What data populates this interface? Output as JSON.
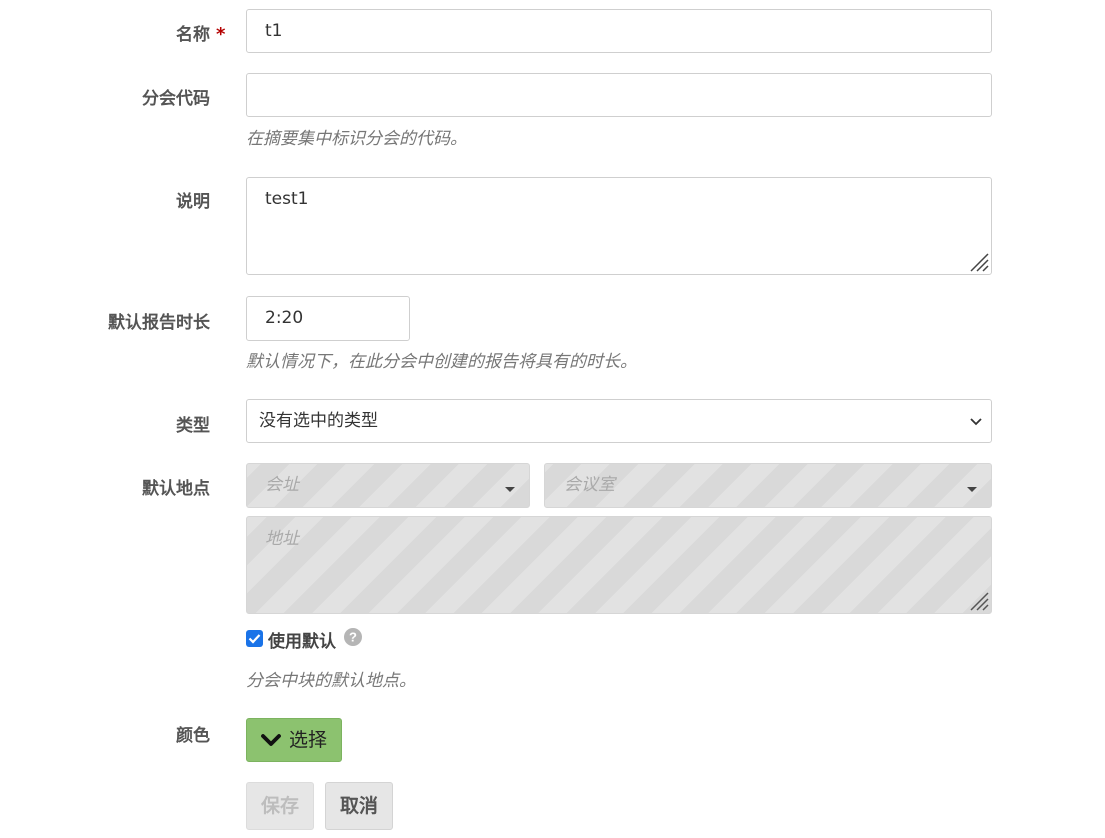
{
  "form": {
    "name": {
      "label": "名称",
      "required_mark": "*",
      "value": "t1"
    },
    "code": {
      "label": "分会代码",
      "value": "",
      "help": "在摘要集中标识分会的代码。"
    },
    "description": {
      "label": "说明",
      "value": "test1"
    },
    "duration": {
      "label": "默认报告时长",
      "value": "2:20",
      "help": "默认情况下，在此分会中创建的报告将具有的时长。"
    },
    "type": {
      "label": "类型",
      "selected": "没有选中的类型"
    },
    "location": {
      "label": "默认地点",
      "venue_placeholder": "会址",
      "room_placeholder": "会议室",
      "address_placeholder": "地址",
      "use_default_label": "使用默认",
      "use_default_checked": true,
      "help": "分会中块的默认地点。"
    },
    "color": {
      "label": "颜色",
      "button_label": "选择",
      "button_color": "#8cc26f"
    },
    "actions": {
      "save_label": "保存",
      "cancel_label": "取消"
    }
  }
}
